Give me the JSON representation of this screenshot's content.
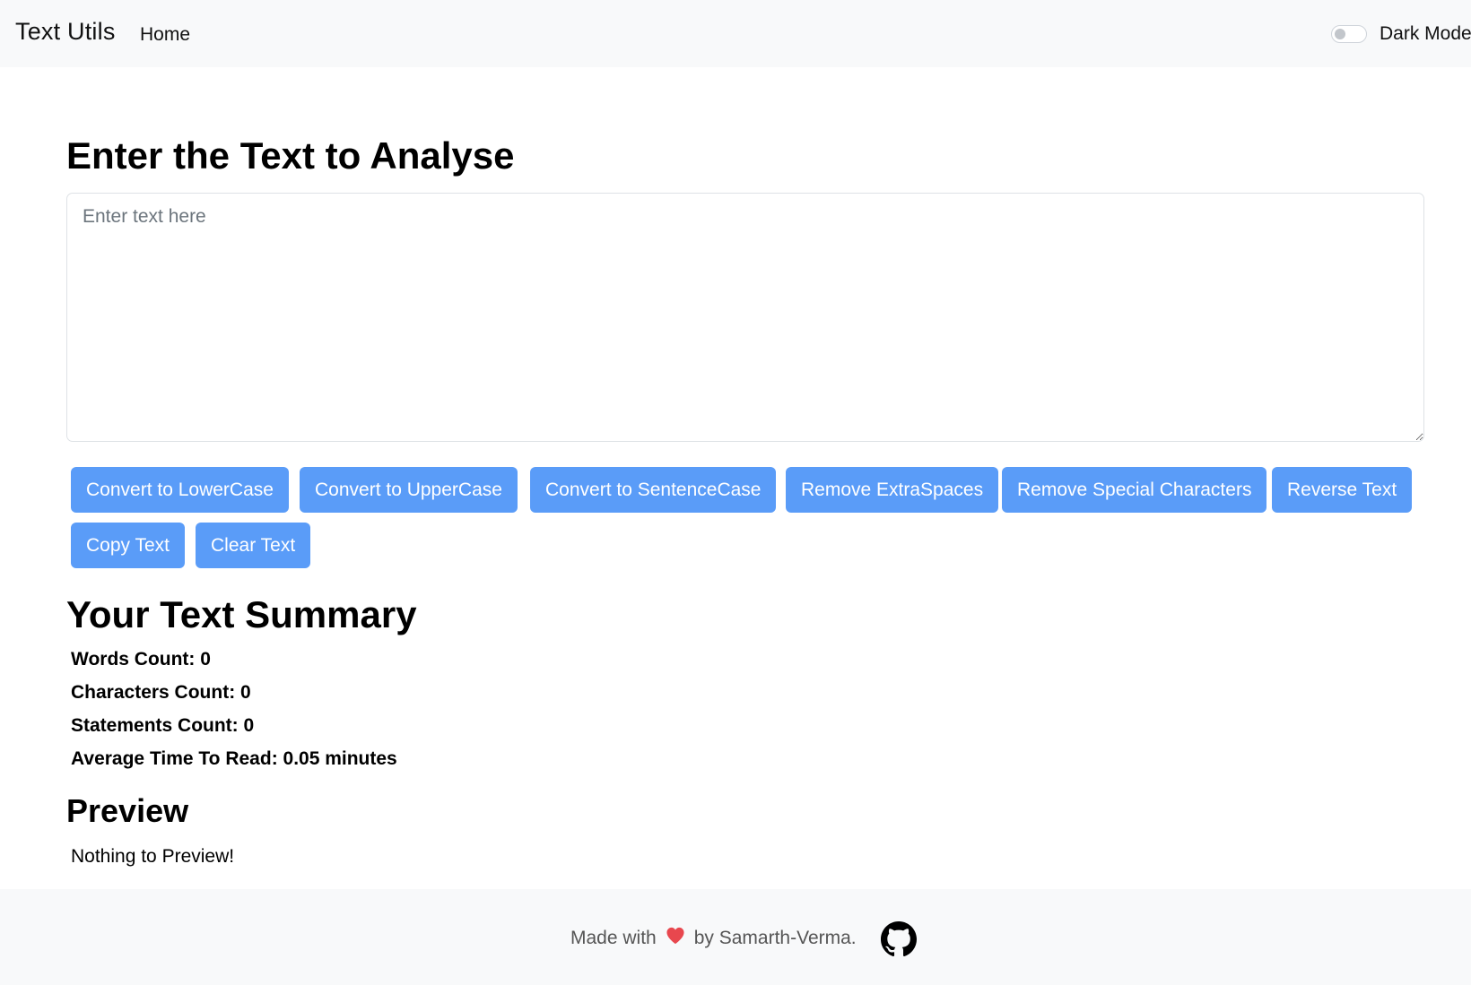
{
  "navbar": {
    "brand": "Text Utils",
    "home_label": "Home",
    "dark_mode_label": "Dark Mode"
  },
  "main": {
    "title": "Enter the Text to Analyse",
    "textarea": {
      "placeholder": "Enter text here",
      "value": ""
    },
    "buttons": [
      "Convert to LowerCase",
      "Convert to UpperCase",
      "Convert to SentenceCase",
      "Remove ExtraSpaces",
      "Remove Special Characters",
      "Reverse Text",
      "Copy Text",
      "Clear Text"
    ]
  },
  "summary": {
    "title": "Your Text Summary",
    "words": "Words Count: 0",
    "characters": "Characters Count: 0",
    "statements": "Statements Count: 0",
    "read_time": "Average Time To Read: 0.05 minutes"
  },
  "preview": {
    "title": "Preview",
    "text": "Nothing to Preview!"
  },
  "footer": {
    "made_with": "Made with",
    "by": "by Samarth-Verma."
  },
  "colors": {
    "button": "#5a9cf8",
    "navbar_bg": "#f8f9fa",
    "heart": "#e8474e"
  },
  "icons": {
    "heart": "heart-icon",
    "github": "github-icon"
  }
}
